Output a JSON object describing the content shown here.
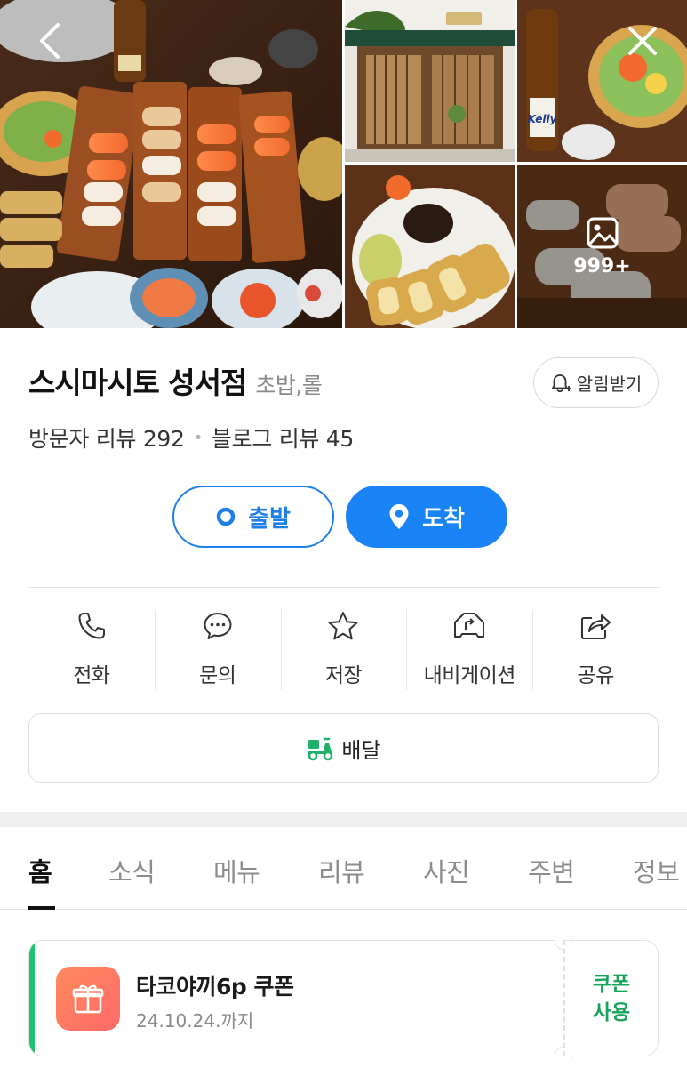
{
  "gallery": {
    "photo_count": "999+",
    "photos": [
      "sushi-platter",
      "storefront",
      "beer-and-salad",
      "katsu-plate",
      "nigiri-closeup"
    ],
    "beer_label": "Kelly"
  },
  "place": {
    "name": "스시마시토 성서점",
    "category": "초밥,롤",
    "notify_label": "알림받기",
    "visitor_reviews_label": "방문자 리뷰",
    "visitor_reviews_count": "292",
    "blog_reviews_label": "블로그 리뷰",
    "blog_reviews_count": "45"
  },
  "route": {
    "depart_label": "출발",
    "arrive_label": "도착"
  },
  "actions": [
    {
      "label": "전화",
      "icon": "phone-icon"
    },
    {
      "label": "문의",
      "icon": "chat-icon"
    },
    {
      "label": "저장",
      "icon": "star-icon"
    },
    {
      "label": "내비게이션",
      "icon": "navigation-icon"
    },
    {
      "label": "공유",
      "icon": "share-icon"
    }
  ],
  "delivery": {
    "label": "배달",
    "icon": "delivery-scooter-icon"
  },
  "tabs": [
    {
      "label": "홈",
      "active": true
    },
    {
      "label": "소식",
      "active": false
    },
    {
      "label": "메뉴",
      "active": false
    },
    {
      "label": "리뷰",
      "active": false
    },
    {
      "label": "사진",
      "active": false
    },
    {
      "label": "주변",
      "active": false
    },
    {
      "label": "정보",
      "active": false
    }
  ],
  "coupon": {
    "title": "타코야끼6p 쿠폰",
    "expiry": "24.10.24.까지",
    "action_line1": "쿠폰",
    "action_line2": "사용",
    "icon": "gift-icon"
  },
  "colors": {
    "primary_blue": "#1a83f5",
    "coupon_green": "#17a35b",
    "coupon_bar": "#20c16f"
  }
}
